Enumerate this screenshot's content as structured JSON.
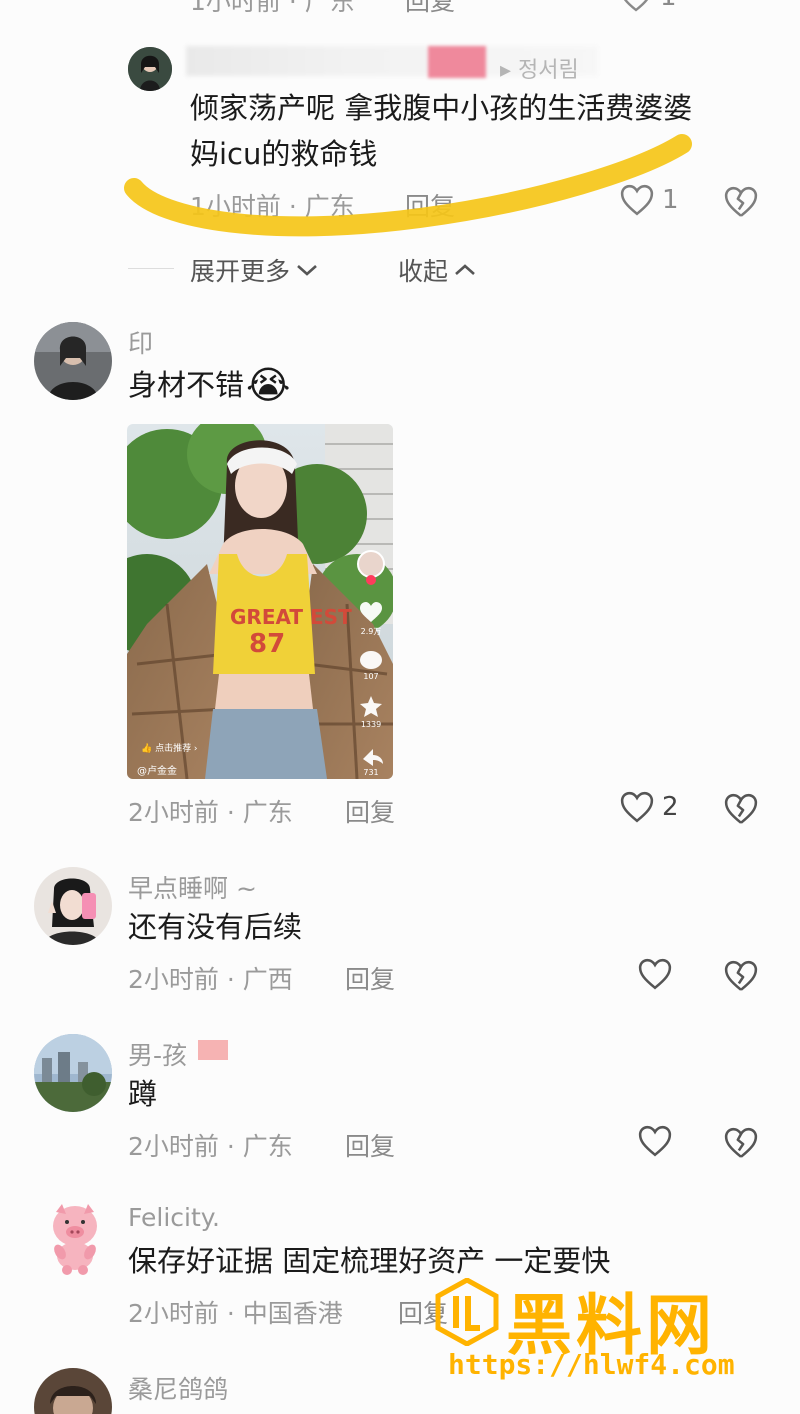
{
  "top_partial": {
    "meta": "1小时前 · 广东",
    "reply": "回复",
    "like_count": "1"
  },
  "reply_comment": {
    "username_suffix": "▸ 정서림",
    "text_line1": "倾家荡产呢 拿我腹中小孩的生活费婆婆",
    "text_line2": "妈icu的救命钱",
    "meta": "1小时前 · 广东",
    "reply": "回复",
    "like_count": "1",
    "expand_more": "展开更多",
    "collapse": "收起",
    "highlight_color": "#f5c518"
  },
  "comments": [
    {
      "username": "印",
      "text": "身材不错",
      "emoji": "😭",
      "meta": "2小时前 · 广东",
      "reply": "回复",
      "like_count": "2",
      "video_overlay": {
        "shirt_text": "GREAT EST 87",
        "recommend": "点击推荐",
        "author": "@卢金金",
        "counts": [
          "2.9万",
          "107",
          "1339",
          "731"
        ]
      }
    },
    {
      "username": "早点睡啊 ~",
      "text": "还有没有后续",
      "meta": "2小时前 · 广西",
      "reply": "回复",
      "like_count": ""
    },
    {
      "username": "男-孩",
      "text": "蹲",
      "meta": "2小时前 · 广东",
      "reply": "回复",
      "like_count": ""
    },
    {
      "username": "Felicity.",
      "text": "保存好证据 固定梳理好资产 一定要快",
      "meta": "2小时前 · 中国香港",
      "reply": "回复",
      "like_count": ""
    },
    {
      "username": "桑尼鸽鸽",
      "text": ""
    }
  ],
  "watermark": {
    "title": "黑料网",
    "url": "https://hlwf4.com",
    "color": "#ffb300"
  },
  "icons": {
    "like": "heart-outline-icon",
    "dislike": "broken-heart-icon",
    "chevron_down": "chevron-down-icon",
    "chevron_up": "chevron-up-icon"
  }
}
